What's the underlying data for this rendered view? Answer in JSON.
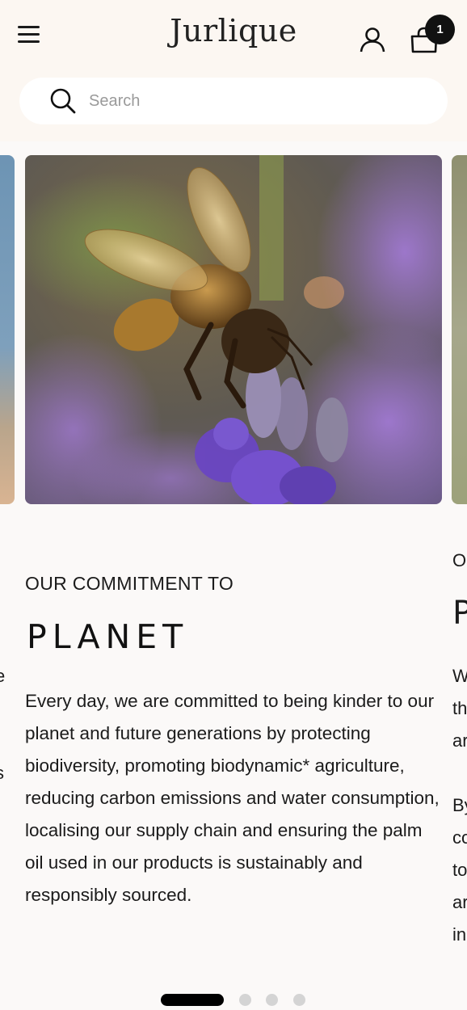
{
  "header": {
    "logo": "Jurlique",
    "cart_count": "1",
    "search_placeholder": "Search"
  },
  "slide": {
    "eyebrow": "OUR COMMITMENT TO",
    "heading": "PLANET",
    "body": "Every day, we are committed to being kinder to our planet and future generations by protecting biodiversity, promoting biodynamic* agriculture, reducing carbon emissions and water consumption, localising our supply chain and ensuring the palm oil used in our products is sustainably and responsibly sourced."
  },
  "next_slide_peek": {
    "eyebrow": "O",
    "heading": "P",
    "lines": [
      "W",
      "th",
      "ar",
      "",
      "By",
      "co",
      "to",
      "ar",
      "in"
    ]
  },
  "prev_slide_peek": {
    "lines": [
      "e",
      "s"
    ]
  },
  "pagination": {
    "total": 4,
    "active": 1
  },
  "colors": {
    "header_bg": "#fcf7f2",
    "page_bg": "#fbf9f8",
    "text": "#1b1b1b",
    "active_dot": "#000000",
    "inactive_dot": "#d4d4d4"
  },
  "icons": [
    "menu-icon",
    "user-icon",
    "bag-icon",
    "search-icon"
  ]
}
